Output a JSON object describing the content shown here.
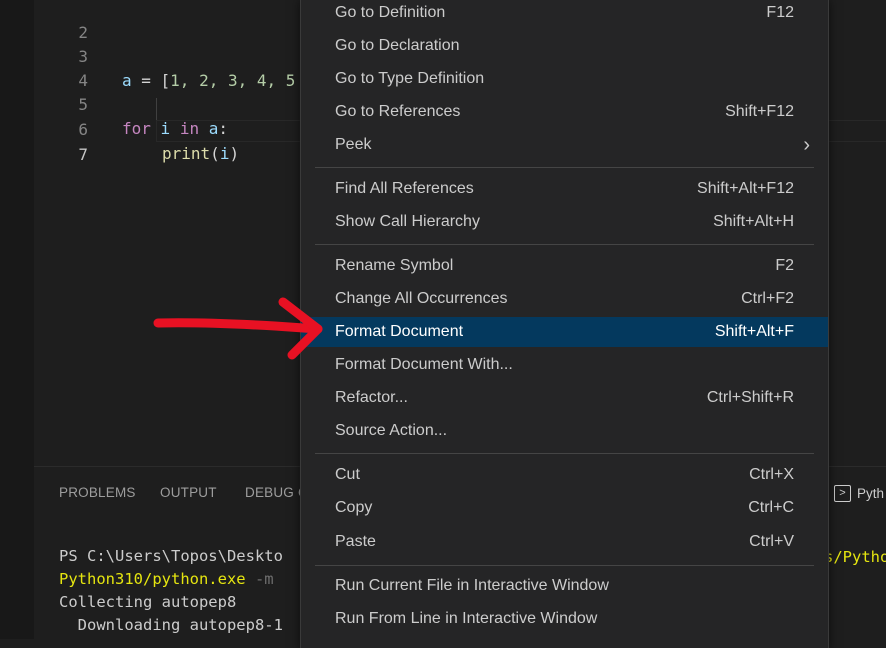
{
  "editor": {
    "lines": [
      {
        "number": "2",
        "code": ""
      },
      {
        "number": "3",
        "code": "a = [1, 2, 3, 4, 5"
      },
      {
        "number": "4",
        "code": ""
      },
      {
        "number": "5",
        "code": "for i in a:"
      },
      {
        "number": "6",
        "code": "    print(i)"
      },
      {
        "number": "7",
        "code": ""
      }
    ],
    "tokens": {
      "line3": {
        "var": "a",
        "op": " = [",
        "nums": "1, 2, 3, 4, 5"
      },
      "line5": {
        "kw1": "for",
        "var1": "i",
        "kw2": "in",
        "var2": "a",
        "colon": ":"
      },
      "line6": {
        "fn": "print",
        "open": "(",
        "arg": "i",
        "close": ")"
      }
    }
  },
  "panel": {
    "tabs": [
      "PROBLEMS",
      "OUTPUT",
      "DEBUG C"
    ],
    "terminal_tab": "Pyth",
    "terminal_lines": [
      "PS C:\\Users\\Topos\\Deskto",
      "Python310/python.exe",
      "Collecting autopep8",
      "  Downloading autopep8-1"
    ],
    "terminal_flag": " -m",
    "terminal_right": "s/Pytho"
  },
  "context_menu": {
    "items": [
      {
        "label": "Go to Definition",
        "shortcut": "F12"
      },
      {
        "label": "Go to Declaration",
        "shortcut": ""
      },
      {
        "label": "Go to Type Definition",
        "shortcut": ""
      },
      {
        "label": "Go to References",
        "shortcut": "Shift+F12"
      },
      {
        "label": "Peek",
        "shortcut": ""
      },
      {
        "label": "Find All References",
        "shortcut": "Shift+Alt+F12"
      },
      {
        "label": "Show Call Hierarchy",
        "shortcut": "Shift+Alt+H"
      },
      {
        "label": "Rename Symbol",
        "shortcut": "F2"
      },
      {
        "label": "Change All Occurrences",
        "shortcut": "Ctrl+F2"
      },
      {
        "label": "Format Document",
        "shortcut": "Shift+Alt+F"
      },
      {
        "label": "Format Document With...",
        "shortcut": ""
      },
      {
        "label": "Refactor...",
        "shortcut": "Ctrl+Shift+R"
      },
      {
        "label": "Source Action...",
        "shortcut": ""
      },
      {
        "label": "Cut",
        "shortcut": "Ctrl+X"
      },
      {
        "label": "Copy",
        "shortcut": "Ctrl+C"
      },
      {
        "label": "Paste",
        "shortcut": "Ctrl+V"
      },
      {
        "label": "Run Current File in Interactive Window",
        "shortcut": ""
      },
      {
        "label": "Run From Line in Interactive Window",
        "shortcut": ""
      }
    ],
    "selected_label": "Format Document",
    "submenu_arrow": "›"
  },
  "colors": {
    "menu_selected": "#04395e",
    "annotation_arrow": "#e81123"
  },
  "icons": {
    "terminal": "terminal-icon",
    "submenu": "chevron-right-icon",
    "annotation": "red-arrow-annotation"
  }
}
